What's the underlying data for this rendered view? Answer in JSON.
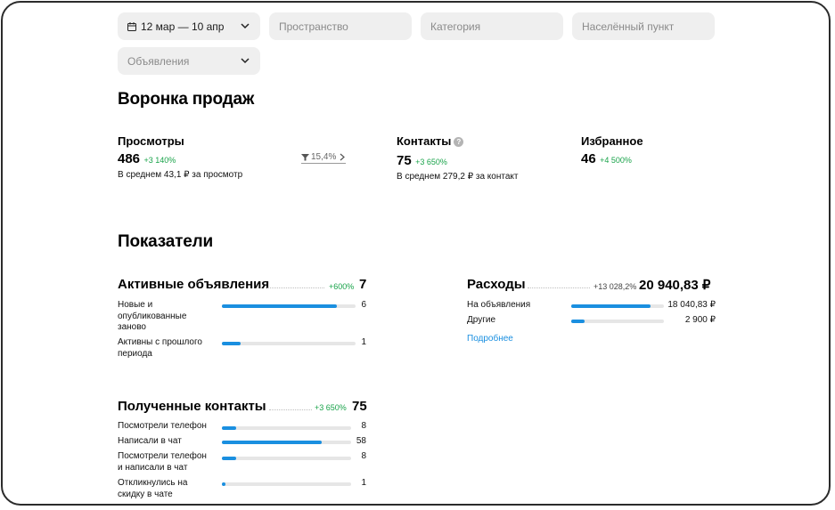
{
  "filters": {
    "date": "12 мар — 10 апр",
    "space": "Пространство",
    "category": "Категория",
    "locality": "Населённый пункт",
    "ads": "Объявления"
  },
  "funnel": {
    "title": "Воронка продаж",
    "views": {
      "label": "Просмотры",
      "value": "486",
      "delta": "+3 140%",
      "note": "В среднем 43,1 ₽ за просмотр"
    },
    "conversion": "15,4%",
    "contacts": {
      "label": "Контакты",
      "help": "?",
      "value": "75",
      "delta": "+3 650%",
      "note": "В среднем 279,2 ₽ за контакт"
    },
    "favorites": {
      "label": "Избранное",
      "value": "46",
      "delta": "+4 500%"
    }
  },
  "indicators": {
    "title": "Показатели",
    "active": {
      "title": "Активные объявления",
      "delta": "+600%",
      "total": "7",
      "rows": [
        {
          "label": "Новые и опубликованные заново",
          "value": "6",
          "fraction": 0.86
        },
        {
          "label": "Активны с прошлого периода",
          "value": "1",
          "fraction": 0.14
        }
      ]
    },
    "expenses": {
      "title": "Расходы",
      "delta": "+13 028,2%",
      "total": "20 940,83 ₽",
      "rows": [
        {
          "label": "На объявления",
          "value": "18 040,83 ₽",
          "fraction": 0.86
        },
        {
          "label": "Другие",
          "value": "2 900 ₽",
          "fraction": 0.14
        }
      ],
      "link": "Подробнее"
    },
    "contacts": {
      "title": "Полученные контакты",
      "delta": "+3 650%",
      "total": "75",
      "rows": [
        {
          "label": "Посмотрели телефон",
          "value": "8",
          "fraction": 0.107
        },
        {
          "label": "Написали в чат",
          "value": "58",
          "fraction": 0.773
        },
        {
          "label": "Посмотрели телефон и написали в чат",
          "value": "8",
          "fraction": 0.107
        },
        {
          "label": "Откликнулись на скидку в чате",
          "value": "1",
          "fraction": 0.027
        }
      ]
    }
  },
  "colors": {
    "accent": "#1a8fe0",
    "positive": "#19a34a",
    "track": "#e6e6e6"
  }
}
